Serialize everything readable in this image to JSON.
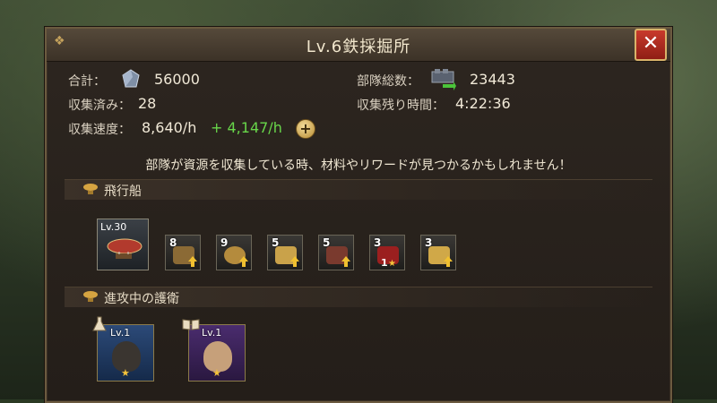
{
  "title": "Lv.6鉄採掘所",
  "stats": {
    "total_label": "合計：",
    "total_value": "56000",
    "troops_label": "部隊総数：",
    "troops_value": "23443",
    "collected_label": "収集済み：",
    "collected_value": "28",
    "remaining_label": "収集残り時間：",
    "remaining_value": "4:22:36",
    "speed_label": "収集速度：",
    "speed_value": "8,640/h",
    "speed_bonus": "+ 4,147/h"
  },
  "note": "部隊が資源を収集している時、材料やリワードが見つかるかもしれません！",
  "airship": {
    "section_label": "飛行船",
    "airship_level": "Lv.30",
    "items": [
      {
        "count": "8",
        "icon": "crate-icon"
      },
      {
        "count": "9",
        "icon": "rope-icon"
      },
      {
        "count": "5",
        "icon": "gear-icon"
      },
      {
        "count": "5",
        "icon": "engine-icon"
      },
      {
        "count": "3",
        "sub": "1",
        "icon": "red-badge-icon"
      },
      {
        "count": "3",
        "icon": "gold-crate-icon"
      }
    ]
  },
  "escort": {
    "section_label": "進攻中の護衛",
    "heroes": [
      {
        "level": "Lv.1",
        "icon": "potion-icon"
      },
      {
        "level": "Lv.1",
        "icon": "book-icon"
      }
    ]
  },
  "colors": {
    "accent": "#d9b36a",
    "bonus": "#68d64a",
    "close": "#c83a2c"
  }
}
